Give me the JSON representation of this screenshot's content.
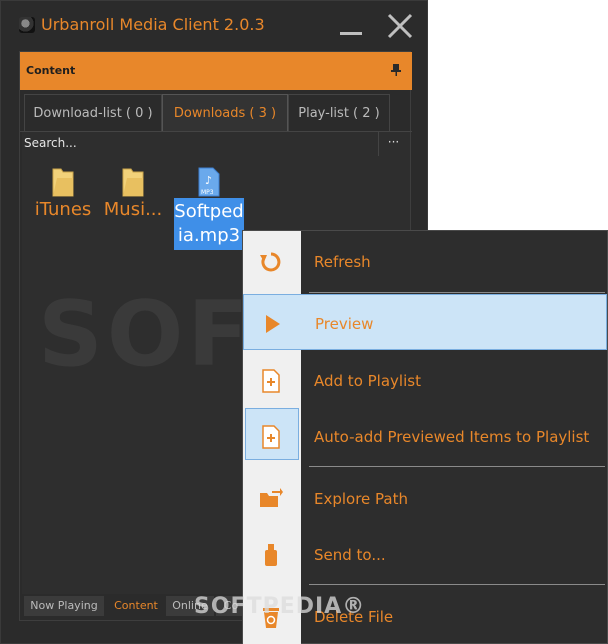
{
  "window": {
    "title": "Urbanroll Media Client 2.0.3"
  },
  "panel": {
    "title": "Content"
  },
  "tabs": [
    {
      "label": "Download-list ( 0 )"
    },
    {
      "label": "Downloads ( 3 )"
    },
    {
      "label": "Play-list ( 2 )"
    }
  ],
  "search": {
    "value": "Search...",
    "more": "···"
  },
  "files": [
    {
      "label": "iTunes",
      "icon": "folder-icon"
    },
    {
      "label": "Musi...",
      "icon": "folder-icon"
    },
    {
      "label": "Softpedia.mp3",
      "icon": "mp3-file-icon",
      "badge": "MP3"
    }
  ],
  "watermark": "SOF",
  "status_tabs": [
    {
      "label": "Now Playing"
    },
    {
      "label": "Content"
    },
    {
      "label": "Online"
    },
    {
      "label": "Co"
    }
  ],
  "context_menu": {
    "items": [
      {
        "label": "Refresh",
        "icon": "refresh-icon"
      },
      {
        "label": "Preview",
        "icon": "play-icon"
      },
      {
        "label": "Add to Playlist",
        "icon": "add-file-icon"
      },
      {
        "label": "Auto-add Previewed Items to Playlist",
        "icon": "add-file-icon"
      },
      {
        "label": "Explore Path",
        "icon": "folder-arrow-icon"
      },
      {
        "label": "Send to...",
        "icon": "usb-drive-icon"
      },
      {
        "label": "Delete File",
        "icon": "recycle-bin-icon"
      }
    ]
  },
  "overlay_watermark": "SOFTPEDIA®",
  "colors": {
    "accent": "#e8872a",
    "background": "#2b2b2b",
    "selection": "#3f8fe8",
    "menu_highlight": "#cce4f7"
  }
}
